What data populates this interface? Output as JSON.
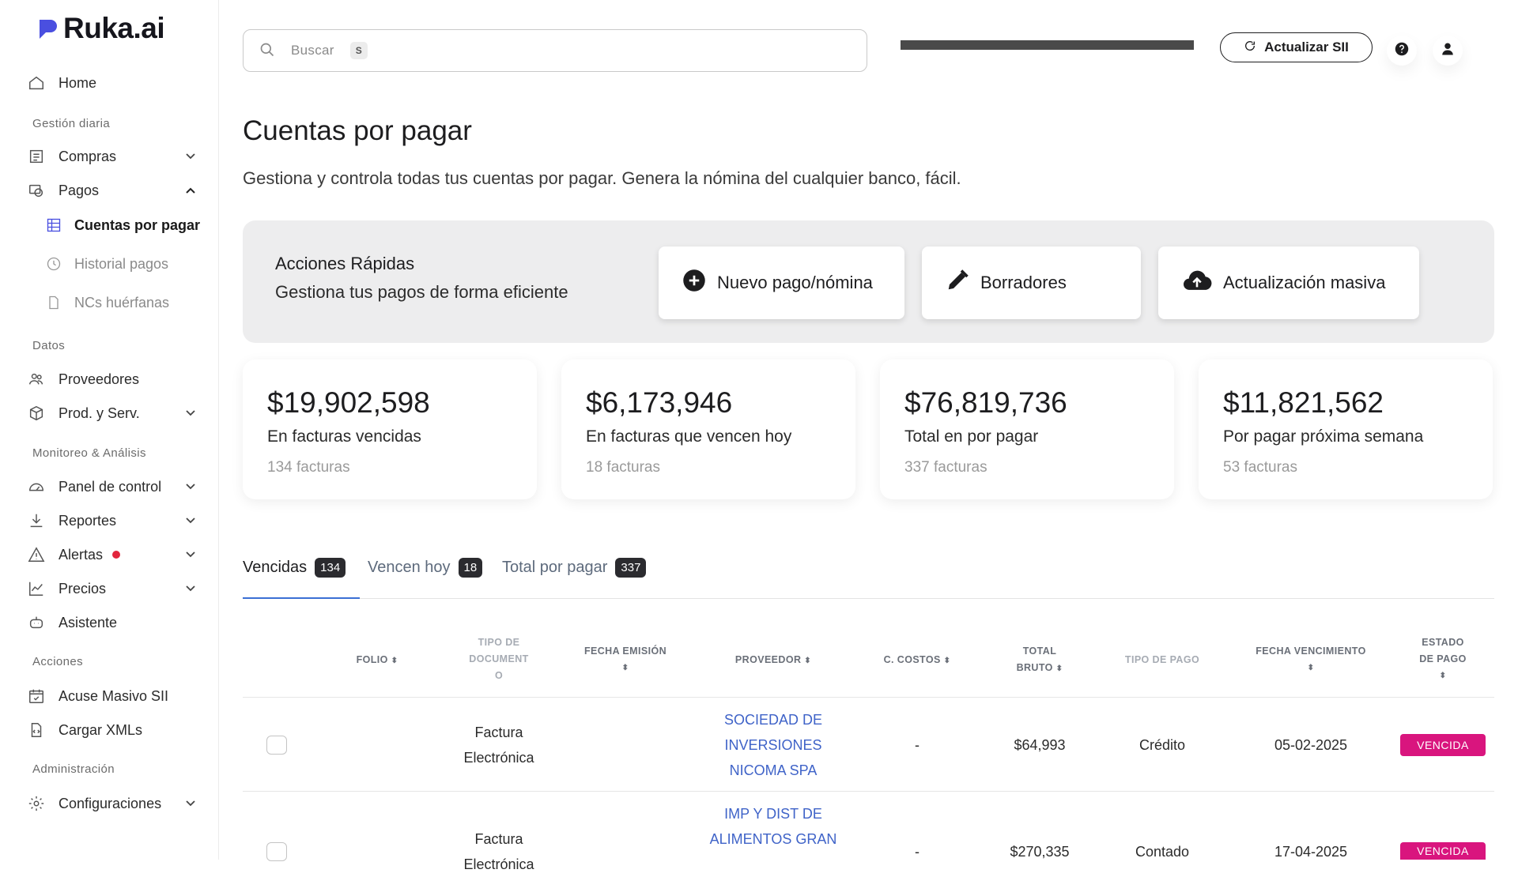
{
  "brand": {
    "name": "Ruka.ai",
    "accent": "#4a4fe0"
  },
  "sidebar": {
    "home": "Home",
    "sections": {
      "gestion": "Gestión diaria",
      "datos": "Datos",
      "monitoreo": "Monitoreo & Análisis",
      "acciones": "Acciones",
      "admin": "Administración"
    },
    "items": {
      "compras": "Compras",
      "pagos": "Pagos",
      "cuentas": "Cuentas por pagar",
      "historial": "Historial pagos",
      "ncs": "NCs huérfanas",
      "proveedores": "Proveedores",
      "prodserv": "Prod. y Serv.",
      "panel": "Panel de control",
      "reportes": "Reportes",
      "alertas": "Alertas",
      "precios": "Precios",
      "asistente": "Asistente",
      "acuse": "Acuse Masivo SII",
      "xmls": "Cargar XMLs",
      "config": "Configuraciones"
    }
  },
  "topbar": {
    "search_placeholder": "Buscar",
    "search_shortcut": "S",
    "sii_button": "Actualizar SII"
  },
  "header": {
    "title": "Cuentas por pagar",
    "subtitle": "Gestiona y controla todas tus cuentas por pagar. Genera la nómina del cualquier banco, fácil."
  },
  "quick_actions": {
    "title": "Acciones Rápidas",
    "subtitle": "Gestiona tus pagos de forma eficiente",
    "new_payment": "Nuevo pago/nómina",
    "drafts": "Borradores",
    "bulk_update": "Actualización masiva"
  },
  "stats": [
    {
      "amount": "$19,902,598",
      "label": "En facturas vencidas",
      "count": "134 facturas"
    },
    {
      "amount": "$6,173,946",
      "label": "En facturas que vencen hoy",
      "count": "18 facturas"
    },
    {
      "amount": "$76,819,736",
      "label": "Total en por pagar",
      "count": "337 facturas"
    },
    {
      "amount": "$11,821,562",
      "label": "Por pagar próxima semana",
      "count": "53 facturas"
    }
  ],
  "tabs": [
    {
      "label": "Vencidas",
      "count": "134"
    },
    {
      "label": "Vencen hoy",
      "count": "18"
    },
    {
      "label": "Total por pagar",
      "count": "337"
    }
  ],
  "table": {
    "headers": {
      "folio": "FOLIO",
      "tipo_doc_1": "TIPO DE",
      "tipo_doc_2": "DOCUMENT",
      "tipo_doc_3": "O",
      "fecha_emision": "FECHA EMISIÓN",
      "proveedor": "PROVEEDOR",
      "centro_costos": "C. COSTOS",
      "total_1": "TOTAL",
      "total_2": "BRUTO",
      "tipo_pago": "TIPO DE PAGO",
      "fecha_venc": "FECHA VENCIMIENTO",
      "estado_1": "ESTADO",
      "estado_2": "DE PAGO"
    },
    "rows": [
      {
        "tipo_1": "Factura",
        "tipo_2": "Electrónica",
        "prov_1": "SOCIEDAD DE",
        "prov_2": "INVERSIONES",
        "prov_3": "NICOMA SPA",
        "costos": "-",
        "total": "$64,993",
        "tipo_pago": "Crédito",
        "vencimiento": "05-02-2025",
        "estado": "VENCIDA"
      },
      {
        "tipo_1": "Factura",
        "tipo_2": "Electrónica",
        "prov_1": "IMP Y DIST DE",
        "prov_2": "ALIMENTOS GRAN",
        "prov_3": "",
        "costos": "-",
        "total": "$270,335",
        "tipo_pago": "Contado",
        "vencimiento": "17-04-2025",
        "estado": "VENCIDA"
      }
    ]
  }
}
